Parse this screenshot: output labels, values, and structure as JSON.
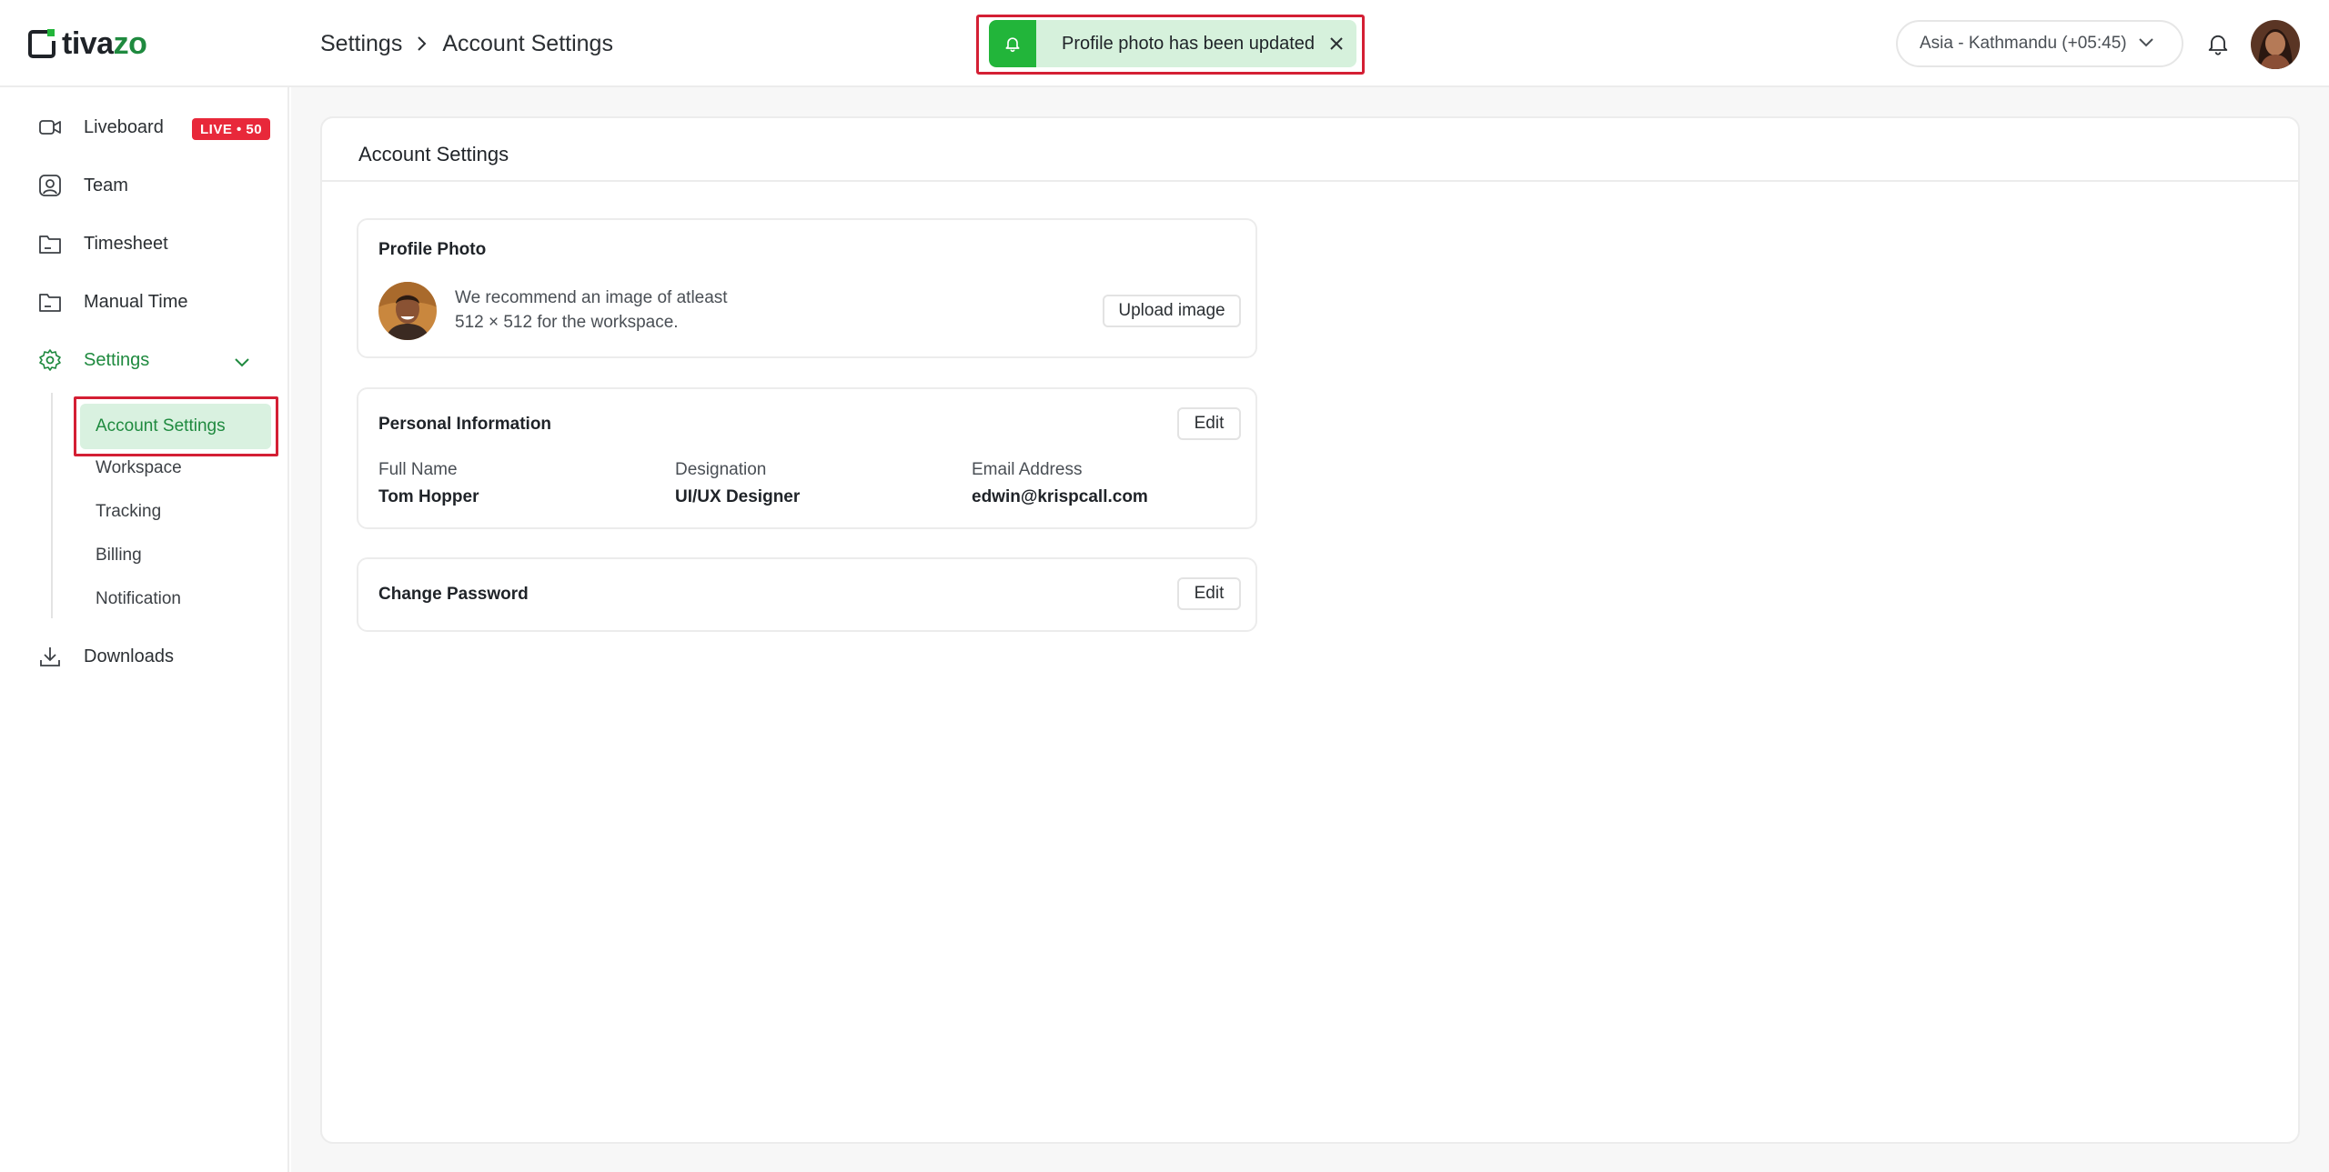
{
  "brand": {
    "name_prefix": "tiva",
    "name_suffix": "zo"
  },
  "breadcrumb": {
    "parent": "Settings",
    "current": "Account Settings"
  },
  "toast": {
    "message": "Profile photo has been updated",
    "color": "#22b53a"
  },
  "header": {
    "timezone": "Asia - Kathmandu (+05:45)"
  },
  "sidebar": {
    "items": [
      {
        "label": "Liveboard",
        "icon": "video-icon"
      },
      {
        "label": "Team",
        "icon": "user-icon"
      },
      {
        "label": "Timesheet",
        "icon": "folder-icon"
      },
      {
        "label": "Manual Time",
        "icon": "folder-icon"
      },
      {
        "label": "Settings",
        "icon": "gear-icon"
      },
      {
        "label": "Downloads",
        "icon": "download-icon"
      }
    ],
    "live_badge": "LIVE • 50",
    "settings_sub": [
      "Account Settings",
      "Workspace",
      "Tracking",
      "Billing",
      "Notification"
    ],
    "accent_color": "#1f8a3f"
  },
  "main": {
    "title": "Account Settings",
    "profile_photo": {
      "title": "Profile Photo",
      "hint_line1": "We recommend an image of atleast",
      "hint_line2": "512 × 512 for the workspace.",
      "upload_label": "Upload image"
    },
    "personal_info": {
      "title": "Personal Information",
      "edit_label": "Edit",
      "fields": [
        {
          "label": "Full Name",
          "value": "Tom Hopper"
        },
        {
          "label": "Designation",
          "value": "UI/UX Designer"
        },
        {
          "label": "Email Address",
          "value": "edwin@krispcall.com"
        }
      ]
    },
    "change_password": {
      "title": "Change Password",
      "edit_label": "Edit"
    }
  }
}
